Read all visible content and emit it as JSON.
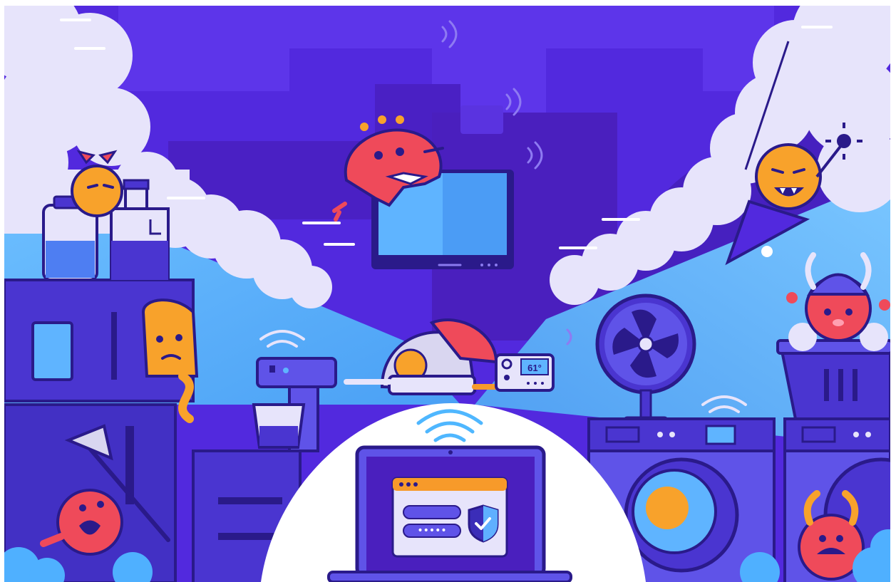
{
  "scene": {
    "colors": {
      "sky_top": "#5b2fe6",
      "sky_deep": "#4a21c9",
      "sky_blue": "#5fb0ff",
      "wall": "#4b3ad6",
      "furniture": "#3b2db8",
      "outline": "#2a1a8a",
      "screen": "#5fb4ff",
      "cloud": "#e6e4fb",
      "monster_orange": "#f8a22b",
      "monster_red": "#ef4a5a",
      "shield": "#3b2db8",
      "shield_check": "#5fb0ff",
      "wifi": "#4fb7ff",
      "accent_orange": "#f79a2a"
    },
    "thermostat": {
      "reading": "61°"
    },
    "laptop": {
      "password_mask": "•••••",
      "icons": [
        "wifi-icon",
        "shield-check-icon",
        "browser-window-icon"
      ]
    }
  }
}
